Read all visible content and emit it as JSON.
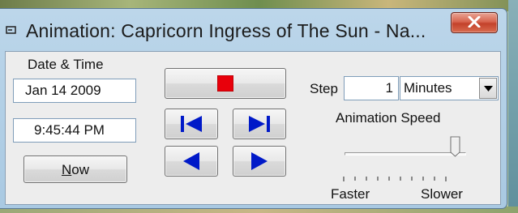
{
  "window": {
    "title": "Animation: Capricorn Ingress of The Sun - Na...",
    "close_label": "X"
  },
  "datetime": {
    "label": "Date & Time",
    "date": "Jan 14 2009",
    "time": "9:45:44 PM",
    "now_underlined": "N",
    "now_rest": "ow"
  },
  "step": {
    "label": "Step",
    "value": "1",
    "unit": "Minutes"
  },
  "speed": {
    "label": "Animation Speed",
    "min_label": "Faster",
    "max_label": "Slower",
    "value_fraction": 0.95
  },
  "controls": {
    "stop_icon": "stop-icon",
    "first_icon": "skip-to-start-icon",
    "last_icon": "skip-to-end-icon",
    "back_icon": "step-back-icon",
    "forward_icon": "step-forward-icon",
    "stop_color": "#e8000b",
    "arrow_color": "#0019c8"
  }
}
